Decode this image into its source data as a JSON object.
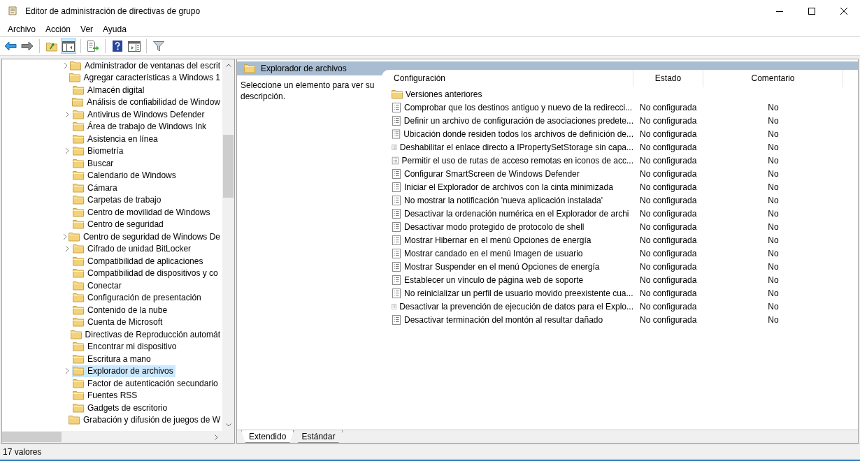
{
  "window": {
    "title": "Editor de administración de directivas de grupo"
  },
  "menu": [
    "Archivo",
    "Acción",
    "Ver",
    "Ayuda"
  ],
  "toolbar": [
    {
      "kind": "back",
      "pressed": false
    },
    {
      "kind": "forward",
      "pressed": false
    },
    {
      "kind": "sep"
    },
    {
      "kind": "up",
      "pressed": false
    },
    {
      "kind": "tree",
      "pressed": true
    },
    {
      "kind": "sep"
    },
    {
      "kind": "export",
      "pressed": false
    },
    {
      "kind": "sep"
    },
    {
      "kind": "help",
      "pressed": false
    },
    {
      "kind": "pane",
      "pressed": false
    },
    {
      "kind": "sep"
    },
    {
      "kind": "filter",
      "pressed": false
    }
  ],
  "tree": [
    {
      "label": "Administrador de ventanas del escrit",
      "expandable": true,
      "selected": false
    },
    {
      "label": "Agregar características a Windows 1",
      "expandable": false,
      "selected": false
    },
    {
      "label": "Almacén digital",
      "expandable": false,
      "selected": false
    },
    {
      "label": "Análisis de confiabilidad de Window",
      "expandable": false,
      "selected": false
    },
    {
      "label": "Antivirus de Windows Defender",
      "expandable": true,
      "selected": false
    },
    {
      "label": "Área de trabajo de Windows Ink",
      "expandable": false,
      "selected": false
    },
    {
      "label": "Asistencia en línea",
      "expandable": false,
      "selected": false
    },
    {
      "label": "Biometría",
      "expandable": true,
      "selected": false
    },
    {
      "label": "Buscar",
      "expandable": false,
      "selected": false
    },
    {
      "label": "Calendario de Windows",
      "expandable": false,
      "selected": false
    },
    {
      "label": "Cámara",
      "expandable": false,
      "selected": false
    },
    {
      "label": "Carpetas de trabajo",
      "expandable": false,
      "selected": false
    },
    {
      "label": "Centro de movilidad de Windows",
      "expandable": false,
      "selected": false
    },
    {
      "label": "Centro de seguridad",
      "expandable": false,
      "selected": false
    },
    {
      "label": "Centro de seguridad de Windows De",
      "expandable": true,
      "selected": false
    },
    {
      "label": "Cifrado de unidad BitLocker",
      "expandable": true,
      "selected": false
    },
    {
      "label": "Compatibilidad de aplicaciones",
      "expandable": false,
      "selected": false
    },
    {
      "label": "Compatibilidad de dispositivos y co",
      "expandable": false,
      "selected": false
    },
    {
      "label": "Conectar",
      "expandable": false,
      "selected": false
    },
    {
      "label": "Configuración de presentación",
      "expandable": false,
      "selected": false
    },
    {
      "label": "Contenido de la nube",
      "expandable": false,
      "selected": false
    },
    {
      "label": "Cuenta de Microsoft",
      "expandable": false,
      "selected": false
    },
    {
      "label": "Directivas de Reproducción automát",
      "expandable": false,
      "selected": false
    },
    {
      "label": "Encontrar mi dispositivo",
      "expandable": false,
      "selected": false
    },
    {
      "label": "Escritura a mano",
      "expandable": false,
      "selected": false
    },
    {
      "label": "Explorador de archivos",
      "expandable": true,
      "selected": true
    },
    {
      "label": "Factor de autenticación secundario",
      "expandable": false,
      "selected": false
    },
    {
      "label": "Fuentes RSS",
      "expandable": false,
      "selected": false
    },
    {
      "label": "Gadgets de escritorio",
      "expandable": false,
      "selected": false
    },
    {
      "label": "Grabación y difusión de juegos de W",
      "expandable": false,
      "selected": false
    }
  ],
  "detail": {
    "title": "Explorador de archivos",
    "description": "Seleccione un elemento para ver su descripción.",
    "columns": [
      "Configuración",
      "Estado",
      "Comentario"
    ],
    "rows": [
      {
        "kind": "folder",
        "name": "Versiones anteriores"
      },
      {
        "kind": "setting",
        "name": "Comprobar que los destinos antiguo y nuevo de la redirecci...",
        "state": "No configurada",
        "comment": "No"
      },
      {
        "kind": "setting",
        "name": "Definir un archivo de configuración de asociaciones predete...",
        "state": "No configurada",
        "comment": "No"
      },
      {
        "kind": "setting",
        "name": "Ubicación donde residen todos los archivos de definición de...",
        "state": "No configurada",
        "comment": "No"
      },
      {
        "kind": "setting",
        "name": "Deshabilitar el enlace directo a IPropertySetStorage sin capa...",
        "state": "No configurada",
        "comment": "No"
      },
      {
        "kind": "setting",
        "name": "Permitir el uso de rutas de acceso remotas en iconos de acc...",
        "state": "No configurada",
        "comment": "No"
      },
      {
        "kind": "setting",
        "name": "Configurar SmartScreen de Windows Defender",
        "state": "No configurada",
        "comment": "No"
      },
      {
        "kind": "setting",
        "name": "Iniciar el Explorador de archivos con la cinta minimizada",
        "state": "No configurada",
        "comment": "No"
      },
      {
        "kind": "setting",
        "name": "No mostrar la notificación 'nueva aplicación instalada'",
        "state": "No configurada",
        "comment": "No"
      },
      {
        "kind": "setting",
        "name": "Desactivar la ordenación numérica en el Explorador de archi",
        "state": "No configurada",
        "comment": "No"
      },
      {
        "kind": "setting",
        "name": "Desactivar modo protegido de protocolo de shell",
        "state": "No configurada",
        "comment": "No"
      },
      {
        "kind": "setting",
        "name": "Mostrar Hibernar en el menú Opciones de energía",
        "state": "No configurada",
        "comment": "No"
      },
      {
        "kind": "setting",
        "name": "Mostrar candado en el menú Imagen de usuario",
        "state": "No configurada",
        "comment": "No"
      },
      {
        "kind": "setting",
        "name": "Mostrar Suspender en el menú Opciones de energía",
        "state": "No configurada",
        "comment": "No"
      },
      {
        "kind": "setting",
        "name": "Establecer un vínculo de página web de soporte",
        "state": "No configurada",
        "comment": "No"
      },
      {
        "kind": "setting",
        "name": "No reinicializar un perfil de usuario movido preexistente cua...",
        "state": "No configurada",
        "comment": "No"
      },
      {
        "kind": "setting",
        "name": "Desactivar la prevención de ejecución de datos para el Explo...",
        "state": "No configurada",
        "comment": "No"
      },
      {
        "kind": "setting",
        "name": "Desactivar terminación del montón al resultar dañado",
        "state": "No configurada",
        "comment": "No"
      }
    ],
    "tabs": [
      {
        "label": "Extendido",
        "selected": true
      },
      {
        "label": "Estándar",
        "selected": false
      }
    ]
  },
  "status": "17 valores"
}
